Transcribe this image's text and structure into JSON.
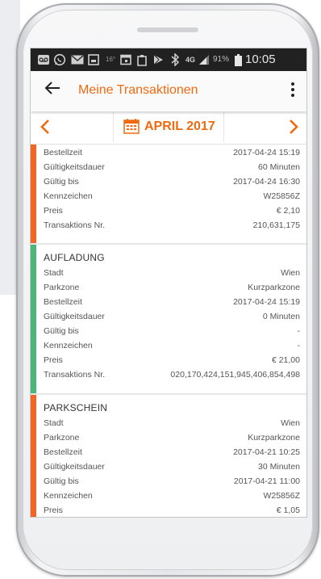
{
  "statusbar": {
    "icons": [
      "voicemail-icon",
      "whatsapp-icon",
      "mail-icon",
      "gallery-icon",
      "cloud-icon",
      "calendar-icon",
      "clipboard-icon",
      "play-store-icon",
      "bluetooth-icon",
      "network-4g-icon",
      "signal-icon",
      "battery-icon"
    ],
    "temperature": "16°",
    "network": "4G",
    "battery": "91%",
    "time": "10:05"
  },
  "appbar": {
    "title": "Meine Transaktionen"
  },
  "month": {
    "label": "APRIL 2017"
  },
  "colors": {
    "accent": "#f06a10",
    "parkschein": "#f26522",
    "aufladung": "#4cb57a"
  },
  "transactions": [
    {
      "type": "",
      "rows": [
        {
          "label": "Bestellzeit",
          "value": "2017-04-24 15:19"
        },
        {
          "label": "Gültigkeitsdauer",
          "value": "60 Minuten"
        },
        {
          "label": "Gültig bis",
          "value": "2017-04-24 16:30"
        },
        {
          "label": "Kennzeichen",
          "value": "W25856Z"
        },
        {
          "label": "Preis",
          "value": "€ 2,10"
        },
        {
          "label": "Transaktions Nr.",
          "value": "210,631,175"
        }
      ]
    },
    {
      "type": "AUFLADUNG",
      "rows": [
        {
          "label": "Stadt",
          "value": "Wien"
        },
        {
          "label": "Parkzone",
          "value": "Kurzparkzone"
        },
        {
          "label": "Bestellzeit",
          "value": "2017-04-24 15:19"
        },
        {
          "label": "Gültigkeitsdauer",
          "value": "0 Minuten"
        },
        {
          "label": "Gültig bis",
          "value": "-"
        },
        {
          "label": "Kennzeichen",
          "value": "-"
        },
        {
          "label": "Preis",
          "value": "€ 21,00"
        },
        {
          "label": "Transaktions Nr.",
          "value": "020,170,424,151,945,406,854,498"
        }
      ]
    },
    {
      "type": "PARKSCHEIN",
      "rows": [
        {
          "label": "Stadt",
          "value": "Wien"
        },
        {
          "label": "Parkzone",
          "value": "Kurzparkzone"
        },
        {
          "label": "Bestellzeit",
          "value": "2017-04-21 10:25"
        },
        {
          "label": "Gültigkeitsdauer",
          "value": "30 Minuten"
        },
        {
          "label": "Gültig bis",
          "value": "2017-04-21 11:00"
        },
        {
          "label": "Kennzeichen",
          "value": "W25856Z"
        },
        {
          "label": "Preis",
          "value": "€ 1,05"
        }
      ]
    }
  ]
}
